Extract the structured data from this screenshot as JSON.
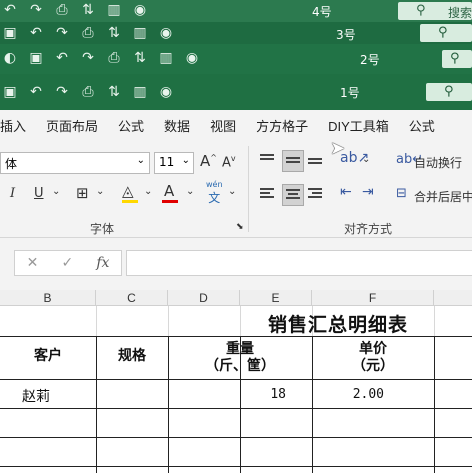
{
  "windows": [
    {
      "title": "4号",
      "search": "搜索"
    },
    {
      "title": "3号"
    },
    {
      "title": "2号"
    },
    {
      "title": "1号"
    }
  ],
  "ribbon_tabs": [
    "插入",
    "页面布局",
    "公式",
    "数据",
    "视图",
    "方方格子",
    "DIY工具箱",
    "公式"
  ],
  "font": {
    "name": "体",
    "size": "11",
    "bold_label": "I",
    "underline_label": "U",
    "wen_label": "wén",
    "wen_char": "文"
  },
  "font_group_label": "字体",
  "alignment_group_label": "对齐方式",
  "wrap_text_label": "自动换行",
  "merge_center_label": "合并后居中",
  "formula_bar": {
    "cancel": "✕",
    "enter": "✓",
    "fx": "fx",
    "value": ""
  },
  "columns": [
    "B",
    "C",
    "D",
    "E",
    "F"
  ],
  "sheet": {
    "title": "销售汇总明细表",
    "headers": {
      "customer": "客户",
      "spec": "规格",
      "weight_line1": "重量",
      "weight_line2": "（斤、筐）",
      "price_line1": "单价",
      "price_line2": "（元）"
    },
    "rows": [
      {
        "customer": "赵莉",
        "spec": "",
        "weight": "18",
        "price": "2.00"
      }
    ]
  },
  "colors": {
    "excel_green": "#217346",
    "ribbon_bg": "#f3f3f3",
    "highlight": "#ffd800",
    "font_color": "#e00000"
  }
}
